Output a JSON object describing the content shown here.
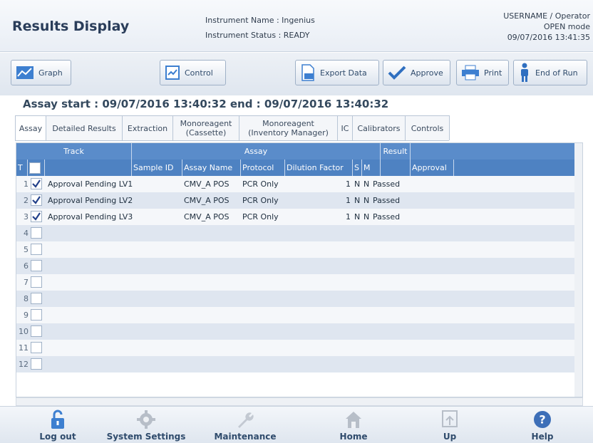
{
  "header": {
    "title": "Results Display",
    "instrument_name": "Instrument Name : Ingenius",
    "instrument_status": "Instrument Status : READY",
    "user": "USERNAME / Operator",
    "mode": "OPEN mode",
    "datetime": "09/07/2016 13:41:35"
  },
  "toolbar": {
    "graph": "Graph",
    "control": "Control",
    "export": "Export Data",
    "approve": "Approve",
    "print": "Print",
    "end_of_run": "End of Run"
  },
  "assay_info": "Assay   start : 09/07/2016 13:40:32   end : 09/07/2016 13:40:32",
  "tabs": [
    {
      "label": "Assay"
    },
    {
      "label": "Detailed Results"
    },
    {
      "label": "Extraction"
    },
    {
      "label": "Monoreagent (Cassette)"
    },
    {
      "label": "Monoreagent (Inventory Manager)"
    },
    {
      "label": "IC"
    },
    {
      "label": "Calibrators"
    },
    {
      "label": "Controls"
    }
  ],
  "table": {
    "group_headers": {
      "track": "Track",
      "assay": "Assay",
      "result": "Result"
    },
    "columns": {
      "t": "T",
      "sample_id": "Sample ID",
      "assay_name": "Assay Name",
      "protocol": "Protocol",
      "dilution": "Dilution Factor",
      "s": "S",
      "m": "M",
      "approval": "Approval"
    },
    "rows": [
      {
        "n": "1",
        "checked": true,
        "track": "Approval Pending LV1",
        "assay_name": "CMV_A POS",
        "protocol": "PCR Only",
        "dilution": "1",
        "s": "N",
        "m": "N",
        "result": "Passed"
      },
      {
        "n": "2",
        "checked": true,
        "track": "Approval Pending LV2",
        "assay_name": "CMV_A POS",
        "protocol": "PCR Only",
        "dilution": "1",
        "s": "N",
        "m": "N",
        "result": "Passed"
      },
      {
        "n": "3",
        "checked": true,
        "track": "Approval Pending LV3",
        "assay_name": "CMV_A POS",
        "protocol": "PCR Only",
        "dilution": "1",
        "s": "N",
        "m": "N",
        "result": "Passed"
      },
      {
        "n": "4",
        "checked": false
      },
      {
        "n": "5",
        "checked": false
      },
      {
        "n": "6",
        "checked": false
      },
      {
        "n": "7",
        "checked": false
      },
      {
        "n": "8",
        "checked": false
      },
      {
        "n": "9",
        "checked": false
      },
      {
        "n": "10",
        "checked": false
      },
      {
        "n": "11",
        "checked": false
      },
      {
        "n": "12",
        "checked": false
      }
    ]
  },
  "footer": {
    "logout": "Log out",
    "settings": "System Settings",
    "maintenance": "Maintenance",
    "home": "Home",
    "up": "Up",
    "help": "Help"
  },
  "icons": [
    "graph-icon",
    "control-icon",
    "export-icon",
    "approve-check-icon",
    "printer-icon",
    "person-icon",
    "lock-icon",
    "gear-icon",
    "wrench-icon",
    "home-icon",
    "up-icon",
    "help-icon"
  ]
}
